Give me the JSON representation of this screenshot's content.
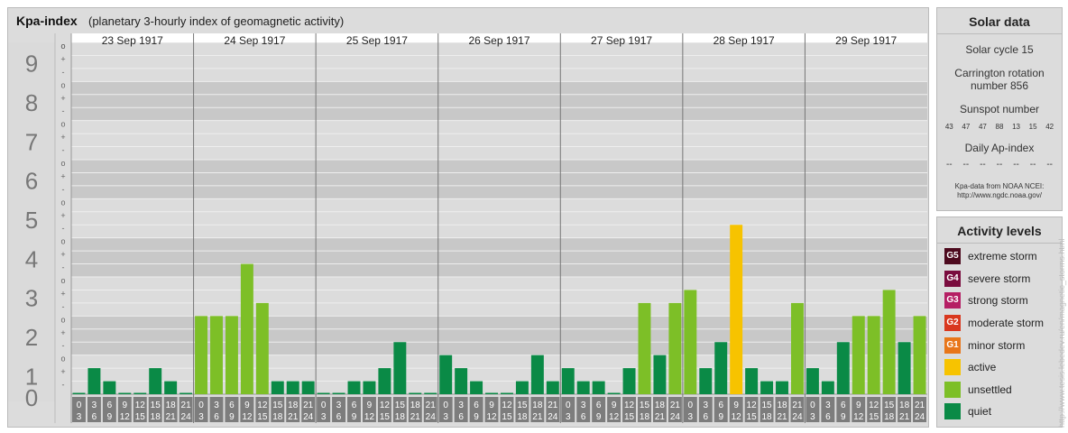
{
  "title": "Kpa-index",
  "subtitle": "(planetary 3-hourly index of geomagnetic activity)",
  "chart_data": {
    "type": "bar",
    "title": "Kpa-index",
    "subtitle": "(planetary 3-hourly index of geomagnetic activity)",
    "ylim": [
      0,
      9
    ],
    "y_ticks": [
      "0",
      "1",
      "2",
      "3",
      "4",
      "5",
      "6",
      "7",
      "8",
      "9"
    ],
    "y_subticks": [
      "-",
      "+",
      "o"
    ],
    "days": [
      "23 Sep 1917",
      "24 Sep 1917",
      "25 Sep 1917",
      "26 Sep 1917",
      "27 Sep 1917",
      "28 Sep 1917",
      "29 Sep 1917"
    ],
    "interval_start": [
      "0",
      "3",
      "6",
      "9",
      "12",
      "15",
      "18",
      "21"
    ],
    "interval_end": [
      "3",
      "6",
      "9",
      "12",
      "15",
      "18",
      "21",
      "24"
    ],
    "values": [
      [
        0.0,
        0.667,
        0.333,
        0.0,
        0.0,
        0.667,
        0.333,
        0.0
      ],
      [
        2.0,
        2.0,
        2.0,
        3.333,
        2.333,
        0.333,
        0.333,
        0.333
      ],
      [
        0.0,
        0.0,
        0.333,
        0.333,
        0.667,
        1.333,
        0.0,
        0.0
      ],
      [
        1.0,
        0.667,
        0.333,
        0.0,
        0.0,
        0.333,
        1.0,
        0.333
      ],
      [
        0.667,
        0.333,
        0.333,
        0.0,
        0.667,
        2.333,
        1.0,
        2.333
      ],
      [
        2.667,
        0.667,
        1.333,
        4.333,
        0.667,
        0.333,
        0.333,
        2.333
      ],
      [
        0.667,
        0.333,
        1.333,
        2.0,
        2.0,
        2.667,
        1.333,
        2.0
      ]
    ],
    "colors": {
      "quiet": "#0a8a46",
      "unsettled": "#7dbf27",
      "active": "#f7c300"
    }
  },
  "solar": {
    "header": "Solar data",
    "solar_cycle": "Solar cycle 15",
    "carrington_line1": "Carrington rotation",
    "carrington_line2": "number 856",
    "sunspot_label": "Sunspot number",
    "sunspots": [
      "43",
      "47",
      "47",
      "88",
      "13",
      "15",
      "42"
    ],
    "ap_label": "Daily Ap-index",
    "ap": [
      "--",
      "--",
      "--",
      "--",
      "--",
      "--",
      "--"
    ],
    "source_line1": "Kpa-data from NOAA NCEI:",
    "source_line2": "http://www.ngdc.noaa.gov/"
  },
  "activity": {
    "header": "Activity levels",
    "levels": [
      {
        "code": "G5",
        "label": "extreme storm",
        "color": "#4d0a1e"
      },
      {
        "code": "G4",
        "label": "severe storm",
        "color": "#7a0c3e"
      },
      {
        "code": "G3",
        "label": "strong storm",
        "color": "#b51f64"
      },
      {
        "code": "G2",
        "label": "moderate storm",
        "color": "#d9381e"
      },
      {
        "code": "G1",
        "label": "minor storm",
        "color": "#e8761a"
      },
      {
        "code": "",
        "label": "active",
        "color": "#f7c300"
      },
      {
        "code": "",
        "label": "unsettled",
        "color": "#7dbf27"
      },
      {
        "code": "",
        "label": "quiet",
        "color": "#0a8a46"
      }
    ]
  },
  "credit": "http://www.tesis.lebedev.ru/en/magnetic_storms.html"
}
